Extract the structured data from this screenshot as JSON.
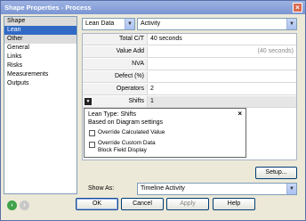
{
  "window": {
    "title": "Shape Properties - Process",
    "close": "×"
  },
  "sidebar": {
    "items": [
      {
        "label": "Shape"
      },
      {
        "label": "Lean"
      },
      {
        "label": "Other"
      },
      {
        "label": "General"
      },
      {
        "label": "Links"
      },
      {
        "label": "Risks"
      },
      {
        "label": "Measurements"
      },
      {
        "label": "Outputs"
      }
    ]
  },
  "toolbar": {
    "category": "Lean Data",
    "subcategory": "Activity"
  },
  "properties": [
    {
      "label": "Total C/T",
      "value": "40 seconds"
    },
    {
      "label": "Value Add",
      "value": "(40 seconds)"
    },
    {
      "label": "NVA",
      "value": ""
    },
    {
      "label": "Defect (%)",
      "value": ""
    },
    {
      "label": "Operators",
      "value": "2"
    },
    {
      "label": "Shifts",
      "value": "1"
    }
  ],
  "popup": {
    "title": "Lean Type: Shifts",
    "subtitle": "Based on Diagram settings",
    "close": "×",
    "option1": "Override Calculated Value",
    "option2_line1": "Override Custom Data",
    "option2_line2": "Block Field Display"
  },
  "setup_button": "Setup...",
  "show_as": {
    "label": "Show As:",
    "value": "Timeline Activity"
  },
  "buttons": {
    "ok": "OK",
    "cancel": "Cancel",
    "apply": "Apply",
    "help": "Help"
  },
  "colors": {
    "selection": "#316ac5",
    "title_bar": "#7b95d2"
  }
}
